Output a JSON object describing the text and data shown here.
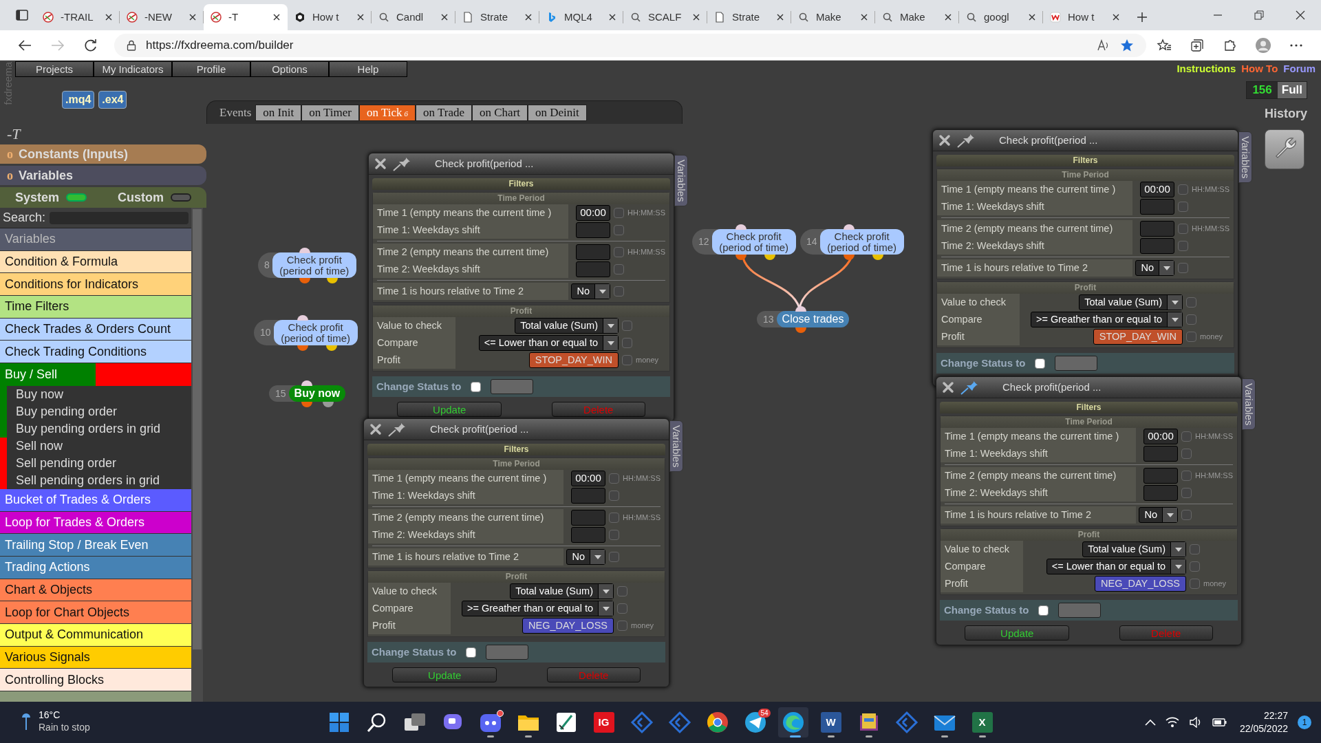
{
  "browser": {
    "tabs": [
      {
        "title": "-TRAIL",
        "kind": "fx",
        "selected": false
      },
      {
        "title": "-NEW",
        "kind": "fx",
        "selected": false
      },
      {
        "title": "-T",
        "kind": "fx",
        "selected": true
      },
      {
        "title": "How t",
        "kind": "hex",
        "selected": false
      },
      {
        "title": "Candl",
        "kind": "search",
        "selected": false
      },
      {
        "title": "Strate",
        "kind": "doc",
        "selected": false
      },
      {
        "title": "MQL4",
        "kind": "bing",
        "selected": false
      },
      {
        "title": "SCALF",
        "kind": "search",
        "selected": false
      },
      {
        "title": "Strate",
        "kind": "doc",
        "selected": false
      },
      {
        "title": "Make",
        "kind": "search",
        "selected": false
      },
      {
        "title": "Make",
        "kind": "search",
        "selected": false
      },
      {
        "title": "googl",
        "kind": "search",
        "selected": false
      },
      {
        "title": "How t",
        "kind": "site",
        "selected": false
      }
    ],
    "address": "https://fxdreema.com/builder"
  },
  "logo": "fxdreema",
  "menu": [
    "Projects",
    "My Indicators",
    "Profile",
    "Options",
    "Help"
  ],
  "help_links": [
    {
      "label": "Instructions",
      "color": "#ccff33"
    },
    {
      "label": "How To",
      "color": "#ff6633"
    },
    {
      "label": "Forum",
      "color": "#9999ff"
    }
  ],
  "file_buttons": [
    ".mq4",
    ".ex4"
  ],
  "events": {
    "label": "Events",
    "tabs": [
      {
        "label": "on Init",
        "selected": false
      },
      {
        "label": "on Timer",
        "selected": false
      },
      {
        "label": "on Tick",
        "badge": "6",
        "selected": true
      },
      {
        "label": "on Trade",
        "selected": false
      },
      {
        "label": "on Chart",
        "selected": false
      },
      {
        "label": "on Deinit",
        "selected": false
      }
    ]
  },
  "counter": {
    "value": "156",
    "label": "Full"
  },
  "history": "History",
  "sidebar": {
    "title": "-T",
    "sections": [
      {
        "prefix": "o",
        "label": "Constants (Inputs)",
        "color": "#a67c52"
      },
      {
        "prefix": "o",
        "label": "Variables",
        "color": "#4d4d5e"
      }
    ],
    "toggles": [
      {
        "label": "System",
        "on": true
      },
      {
        "label": "Custom",
        "on": false
      }
    ],
    "search": {
      "label": "Search:"
    },
    "items": [
      {
        "kind": "heading",
        "label": "Variables",
        "color": "#565a6b"
      },
      {
        "kind": "category",
        "label": "Condition & Formula",
        "color": "#ffe0b3"
      },
      {
        "kind": "category",
        "label": "Conditions for Indicators",
        "color": "#ffd27a"
      },
      {
        "kind": "category",
        "label": "Time Filters",
        "color": "#b3e383"
      },
      {
        "kind": "category",
        "label": "Check Trades & Orders Count",
        "color": "#b3d1ff"
      },
      {
        "kind": "category",
        "label": "Check Trading Conditions",
        "color": "#b3d1ff"
      },
      {
        "kind": "split",
        "label": "Buy / Sell",
        "color": "#008000",
        "accent": {
          "color": "#ff0000"
        }
      },
      {
        "kind": "sub",
        "label": "Buy now",
        "color": "#008000"
      },
      {
        "kind": "sub",
        "label": "Buy pending order",
        "color": "#008000"
      },
      {
        "kind": "sub",
        "label": "Buy pending orders in grid",
        "color": "#008000"
      },
      {
        "kind": "sub",
        "label": "Sell now",
        "color": "#ff0000"
      },
      {
        "kind": "sub",
        "label": "Sell pending order",
        "color": "#ff0000"
      },
      {
        "kind": "sub",
        "label": "Sell pending orders in grid",
        "color": "#ff0000"
      },
      {
        "kind": "category",
        "label": "Bucket of Trades & Orders",
        "color": "#5b5bff"
      },
      {
        "kind": "category",
        "label": "Loop for Trades & Orders",
        "color": "#cc00cc"
      },
      {
        "kind": "category",
        "label": "Trailing Stop / Break Even",
        "color": "#4682b4"
      },
      {
        "kind": "category",
        "label": "Trading Actions",
        "color": "#4682b4"
      },
      {
        "kind": "category",
        "label": "Chart & Objects",
        "color": "#ff7f50"
      },
      {
        "kind": "category",
        "label": "Loop for Chart Objects",
        "color": "#ff7f50"
      },
      {
        "kind": "category",
        "label": "Output & Communication",
        "color": "#ffff55"
      },
      {
        "kind": "category",
        "label": "Various Signals",
        "color": "#ffcc00"
      },
      {
        "kind": "category",
        "label": "Controlling Blocks",
        "color": "#ffe9dc"
      },
      {
        "kind": "category",
        "color": "#8b9a7a"
      }
    ]
  },
  "blocks": [
    {
      "number": "8",
      "label": "Check profit (period of time)",
      "kind": "condition",
      "outputs": [
        {
          "color": "#e8600a"
        },
        {
          "color": "#e8c000"
        }
      ]
    },
    {
      "number": "10",
      "label": "Check profit (period of time)",
      "kind": "condition",
      "outputs": [
        {
          "color": "#e8600a"
        },
        {
          "color": "#e8c000"
        }
      ]
    },
    {
      "number": "15",
      "label": "Buy now",
      "kind": "buy",
      "outputs": [
        {
          "color": "#e8600a"
        },
        {
          "color": "#9a9a9a"
        }
      ]
    },
    {
      "number": "12",
      "label": "Check profit (period of time)",
      "kind": "condition",
      "outputs": [
        {
          "color": "#e8600a"
        },
        {
          "color": "#e8c000"
        }
      ]
    },
    {
      "number": "14",
      "label": "Check profit (period of time)",
      "kind": "condition",
      "outputs": [
        {
          "color": "#e8600a"
        },
        {
          "color": "#e8c000"
        }
      ]
    },
    {
      "number": "13",
      "label": "Close trades",
      "kind": "action",
      "outputs": [
        {
          "color": "#e8600a"
        }
      ]
    }
  ],
  "panels": [
    {
      "title": "Check profit(period ...",
      "pinned": false,
      "side_tab": "Variables",
      "header": "Filters",
      "groups": [
        {
          "kind": "time",
          "title": "Time Period",
          "blocks": [
            [
              {
                "kind": "input",
                "label": "Time 1 (empty means the current time )",
                "value": "00:00",
                "unit": "HH:MM:SS",
                "checked": false
              },
              {
                "kind": "input",
                "label": "Time 1: Weekdays shift",
                "checked": false
              }
            ],
            [
              {
                "kind": "input",
                "label": "Time 2 (empty means the current time)",
                "unit": "HH:MM:SS",
                "checked": false
              },
              {
                "kind": "input",
                "label": "Time 2: Weekdays shift",
                "checked": false
              }
            ],
            [
              {
                "kind": "select",
                "label": "Time 1 is hours relative to Time 2",
                "value": "No",
                "checked": false
              }
            ]
          ]
        },
        {
          "kind": "values",
          "title": "Profit",
          "blocks": [
            [
              {
                "kind": "select",
                "label": "Value to check",
                "value": "Total value (Sum)",
                "checked": false
              },
              {
                "kind": "select",
                "label": "Compare",
                "value": "<= Lower than or equal to",
                "checked": false
              },
              {
                "kind": "variable",
                "label": "Profit",
                "value": "STOP_DAY_WIN",
                "color": "#c0502a",
                "unit": "money",
                "checked": false
              }
            ]
          ]
        }
      ],
      "status": {
        "label": "Change Status to",
        "checked": false
      },
      "buttons": [
        {
          "label": "Update",
          "kind": "update"
        },
        {
          "label": "Delete",
          "kind": "delete"
        }
      ]
    },
    {
      "title": "Check profit(period ...",
      "pinned": false,
      "side_tab": "Variables",
      "header": "Filters",
      "groups": [
        {
          "kind": "time",
          "title": "Time Period",
          "blocks": [
            [
              {
                "kind": "input",
                "label": "Time 1 (empty means the current time )",
                "value": "00:00",
                "unit": "HH:MM:SS",
                "checked": false
              },
              {
                "kind": "input",
                "label": "Time 1: Weekdays shift",
                "checked": false
              }
            ],
            [
              {
                "kind": "input",
                "label": "Time 2 (empty means the current time)",
                "unit": "HH:MM:SS",
                "checked": false
              },
              {
                "kind": "input",
                "label": "Time 2: Weekdays shift",
                "checked": false
              }
            ],
            [
              {
                "kind": "select",
                "label": "Time 1 is hours relative to Time 2",
                "value": "No",
                "checked": false
              }
            ]
          ]
        },
        {
          "kind": "values",
          "title": "Profit",
          "blocks": [
            [
              {
                "kind": "select",
                "label": "Value to check",
                "value": "Total value (Sum)",
                "checked": false
              },
              {
                "kind": "select",
                "label": "Compare",
                "value": ">= Greather than or equal to",
                "checked": false
              },
              {
                "kind": "variable",
                "label": "Profit",
                "value": "NEG_DAY_LOSS",
                "color": "#4a4ab8",
                "unit": "money",
                "checked": false
              }
            ]
          ]
        }
      ],
      "status": {
        "label": "Change Status to",
        "checked": false
      },
      "buttons": [
        {
          "label": "Update",
          "kind": "update"
        },
        {
          "label": "Delete",
          "kind": "delete"
        }
      ]
    },
    {
      "title": "Check profit(period ...",
      "pinned": false,
      "side_tab": "Variables",
      "header": "Filters",
      "groups": [
        {
          "kind": "time",
          "title": "Time Period",
          "blocks": [
            [
              {
                "kind": "input",
                "label": "Time 1 (empty means the current time )",
                "value": "00:00",
                "unit": "HH:MM:SS",
                "checked": false
              },
              {
                "kind": "input",
                "label": "Time 1: Weekdays shift",
                "checked": false
              }
            ],
            [
              {
                "kind": "input",
                "label": "Time 2 (empty means the current time)",
                "unit": "HH:MM:SS",
                "checked": false
              },
              {
                "kind": "input",
                "label": "Time 2: Weekdays shift",
                "checked": false
              }
            ],
            [
              {
                "kind": "select",
                "label": "Time 1 is hours relative to Time 2",
                "value": "No",
                "checked": false
              }
            ]
          ]
        },
        {
          "kind": "values",
          "title": "Profit",
          "blocks": [
            [
              {
                "kind": "select",
                "label": "Value to check",
                "value": "Total value (Sum)",
                "checked": false
              },
              {
                "kind": "select",
                "label": "Compare",
                "value": ">= Greather than or equal to",
                "checked": false
              },
              {
                "kind": "variable",
                "label": "Profit",
                "value": "STOP_DAY_WIN",
                "color": "#c0502a",
                "unit": "money",
                "checked": false
              }
            ]
          ]
        }
      ],
      "status": {
        "label": "Change Status to",
        "checked": false
      }
    },
    {
      "title": "Check profit(period ...",
      "pinned": true,
      "side_tab": "Variables",
      "header": "Filters",
      "groups": [
        {
          "kind": "time",
          "title": "Time Period",
          "blocks": [
            [
              {
                "kind": "input",
                "label": "Time 1 (empty means the current time )",
                "value": "00:00",
                "unit": "HH:MM:SS",
                "checked": false
              },
              {
                "kind": "input",
                "label": "Time 1: Weekdays shift",
                "checked": false
              }
            ],
            [
              {
                "kind": "input",
                "label": "Time 2 (empty means the current time)",
                "unit": "HH:MM:SS",
                "checked": false
              },
              {
                "kind": "input",
                "label": "Time 2: Weekdays shift",
                "checked": false
              }
            ],
            [
              {
                "kind": "select",
                "label": "Time 1 is hours relative to Time 2",
                "value": "No",
                "checked": false
              }
            ]
          ]
        },
        {
          "kind": "values",
          "title": "Profit",
          "blocks": [
            [
              {
                "kind": "select",
                "label": "Value to check",
                "value": "Total value (Sum)",
                "checked": false
              },
              {
                "kind": "select",
                "label": "Compare",
                "value": "<= Lower than or equal to",
                "checked": false
              },
              {
                "kind": "variable",
                "label": "Profit",
                "value": "NEG_DAY_LOSS",
                "color": "#4a4ab8",
                "unit": "money",
                "checked": false
              }
            ]
          ]
        }
      ],
      "status": {
        "label": "Change Status to",
        "checked": false
      },
      "buttons": [
        {
          "label": "Update",
          "kind": "update"
        },
        {
          "label": "Delete",
          "kind": "delete"
        }
      ]
    }
  ],
  "taskbar": {
    "weather": {
      "temp": "16°C",
      "text": "Rain to stop"
    },
    "apps": [
      {
        "kind": "start",
        "running": false
      },
      {
        "kind": "search",
        "running": false
      },
      {
        "kind": "taskview",
        "running": false
      },
      {
        "kind": "chat",
        "running": false
      },
      {
        "kind": "discord",
        "badge_dot": true,
        "running": true
      },
      {
        "kind": "folder",
        "running": true
      },
      {
        "kind": "slash",
        "running": false
      },
      {
        "kind": "tile",
        "label": "IG",
        "color": "#e0141e",
        "running": false
      },
      {
        "kind": "code",
        "running": false
      },
      {
        "kind": "code",
        "running": false
      },
      {
        "kind": "chrome",
        "running": false
      },
      {
        "kind": "telegram",
        "badge": "54",
        "running": false
      },
      {
        "kind": "edge",
        "running": true
      },
      {
        "kind": "tile",
        "label": "W",
        "color": "#2b579a",
        "running": true
      },
      {
        "kind": "books",
        "running": true
      },
      {
        "kind": "code",
        "running": false
      },
      {
        "kind": "mail",
        "running": true
      },
      {
        "kind": "tile",
        "label": "X",
        "color": "#217346",
        "running": true
      }
    ],
    "time": "22:27",
    "date": "22/05/2022",
    "notifications": "1"
  }
}
